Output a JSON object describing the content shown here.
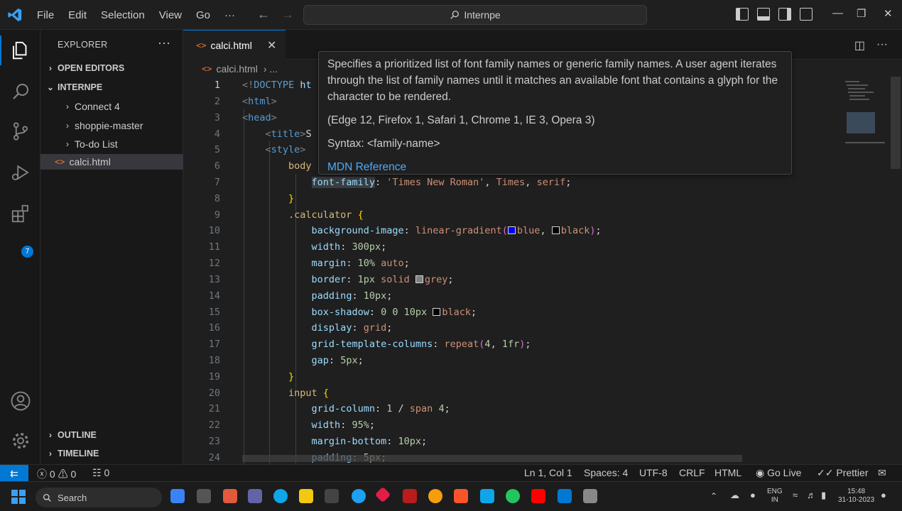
{
  "window": {
    "menu": [
      "File",
      "Edit",
      "Selection",
      "View",
      "Go",
      "···"
    ],
    "command_center": "Internpe"
  },
  "activity_bar": {
    "icons": [
      "files-icon",
      "search-icon",
      "source-control-icon",
      "run-debug-icon",
      "extensions-icon",
      "account-icon",
      "settings-gear-icon"
    ],
    "extensions_badge": "7"
  },
  "sidebar": {
    "title": "EXPLORER",
    "open_editors": "OPEN EDITORS",
    "workspace": "INTERNPE",
    "items": [
      "Connect 4",
      "shoppie-master",
      "To-do List",
      "calci.html"
    ],
    "outline": "OUTLINE",
    "timeline": "TIMELINE"
  },
  "tabs": [
    {
      "label": "calci.html"
    }
  ],
  "breadcrumb": {
    "file": "calci.html",
    "rest": "› ..."
  },
  "editor": {
    "current_line": 1,
    "line_numbers": [
      "1",
      "2",
      "3",
      "4",
      "5",
      "6",
      "7",
      "8",
      "9",
      "10",
      "11",
      "12",
      "13",
      "14",
      "15",
      "16",
      "17",
      "18",
      "19",
      "20",
      "21",
      "22",
      "23",
      "24"
    ]
  },
  "hover": {
    "description": "Specifies a prioritized list of font family names or generic family names. A user agent iterates through the list of family names until it matches an available font that contains a glyph for the character to be rendered.",
    "compat": "(Edge 12, Firefox 1, Safari 1, Chrome 1, IE 3, Opera 3)",
    "syntax": "Syntax: <family-name>",
    "link": "MDN Reference"
  },
  "status": {
    "problems": "ⓧ 0 ⚠ 0",
    "ports": "☷ 0",
    "position": "Ln 1, Col 1",
    "spaces": "Spaces: 4",
    "encoding": "UTF-8",
    "eol": "CRLF",
    "language": "HTML",
    "golive": "Go Live",
    "prettier": "Prettier"
  },
  "taskbar": {
    "search": "Search",
    "lang": "ENG",
    "region": "IN",
    "time": "15:48",
    "date": "31-10-2023"
  },
  "colors": {
    "accent": "#0078d4",
    "swatch_blue": "#0000ff",
    "swatch_black": "#000000",
    "swatch_grey": "#808080"
  }
}
